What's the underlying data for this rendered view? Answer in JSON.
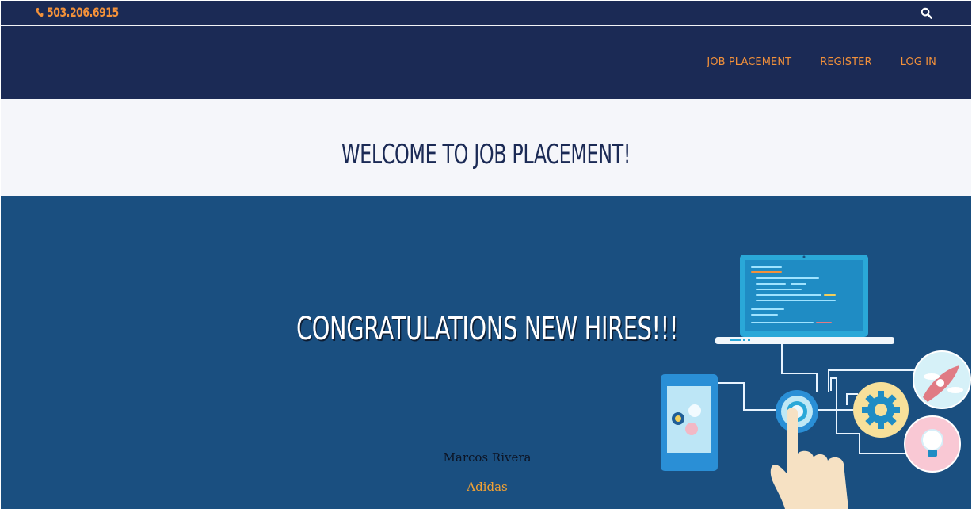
{
  "topbar": {
    "phone": "503.206.6915",
    "phone_icon": "phone-icon",
    "search_icon": "search-icon"
  },
  "nav": {
    "items": [
      {
        "label": "JOB PLACEMENT"
      },
      {
        "label": "REGISTER"
      },
      {
        "label": "LOG IN"
      }
    ]
  },
  "welcome": {
    "title": "WELCOME TO JOB PLACEMENT!"
  },
  "hero": {
    "title": "CONGRATULATIONS NEW HIRES!!!",
    "hire": {
      "name": "Marcos Rivera",
      "company": "Adidas"
    },
    "illustration": "tech-network-illustration"
  },
  "colors": {
    "navy": "#1b2a55",
    "accent": "#f3913a",
    "hero_blue": "#1a4f80",
    "page_bg": "#f5f6fa"
  }
}
